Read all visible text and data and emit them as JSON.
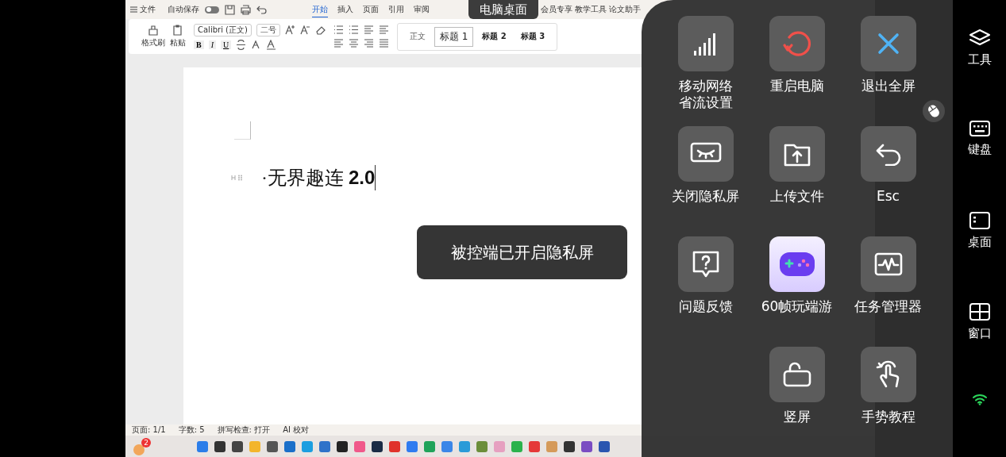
{
  "remote_label": "电脑桌面",
  "editor": {
    "menu": {
      "label": "文件"
    },
    "autosave": {
      "label": "自动保存",
      "on": false
    },
    "tabs": [
      {
        "label": "开始",
        "selected": true
      },
      {
        "label": "插入",
        "selected": false
      },
      {
        "label": "页面",
        "selected": false
      },
      {
        "label": "引用",
        "selected": false
      },
      {
        "label": "审阅",
        "selected": false
      }
    ],
    "tabs_more": [
      {
        "label": "会员专享",
        "selected": false
      },
      {
        "label": "教学工具",
        "selected": false
      },
      {
        "label": "论文助手",
        "selected": false
      }
    ],
    "clipboard": [
      {
        "label": "格式刷"
      },
      {
        "label": "粘贴"
      }
    ],
    "font": {
      "value": "Calibri (正文)"
    },
    "size": {
      "value": "二号"
    },
    "format_buttons": [
      "B",
      "I",
      "U"
    ],
    "styles": [
      {
        "label": "正文",
        "selected": false
      },
      {
        "label": "标题 1",
        "selected": true
      },
      {
        "label": "标题 2",
        "selected": false
      },
      {
        "label": "标题 3",
        "selected": false
      }
    ],
    "document": {
      "text": "·无界趣连 **2.0**"
    },
    "status": [
      "页面: 1/1",
      "字数: 5",
      "拼写检查: 打开",
      "AI 校对"
    ],
    "taskbar": {
      "weather_badge": "2"
    }
  },
  "toast": "被控端已开启隐私屏",
  "panel": {
    "rows": [
      [
        {
          "lines": [
            "移动网络",
            "省流设置"
          ],
          "kind": "signal"
        },
        {
          "lines": [
            "重启电脑"
          ],
          "kind": "restart"
        },
        {
          "lines": [
            "退出全屏"
          ],
          "kind": "close"
        }
      ],
      [
        {
          "lines": [
            "关闭隐私屏"
          ],
          "kind": "privacy"
        },
        {
          "lines": [
            "上传文件"
          ],
          "kind": "upload"
        },
        {
          "lines": [
            "Esc"
          ],
          "kind": "esc"
        }
      ],
      [
        {
          "lines": [
            "问题反馈"
          ],
          "kind": "feedback"
        },
        {
          "lines": [
            "60帧玩端游"
          ],
          "kind": "game"
        },
        {
          "lines": [
            "任务管理器"
          ],
          "kind": "monitor"
        }
      ],
      [
        "",
        {
          "lines": [
            "竖屏"
          ],
          "kind": "rotate"
        },
        {
          "lines": [
            "手势教程"
          ],
          "kind": "gesture"
        }
      ]
    ]
  },
  "sidebar": [
    {
      "label": "工具",
      "kind": "layers"
    },
    {
      "label": "键盘",
      "kind": "keyboard"
    },
    {
      "label": "桌面",
      "kind": "desktop"
    },
    {
      "label": "窗口",
      "kind": "window"
    }
  ]
}
